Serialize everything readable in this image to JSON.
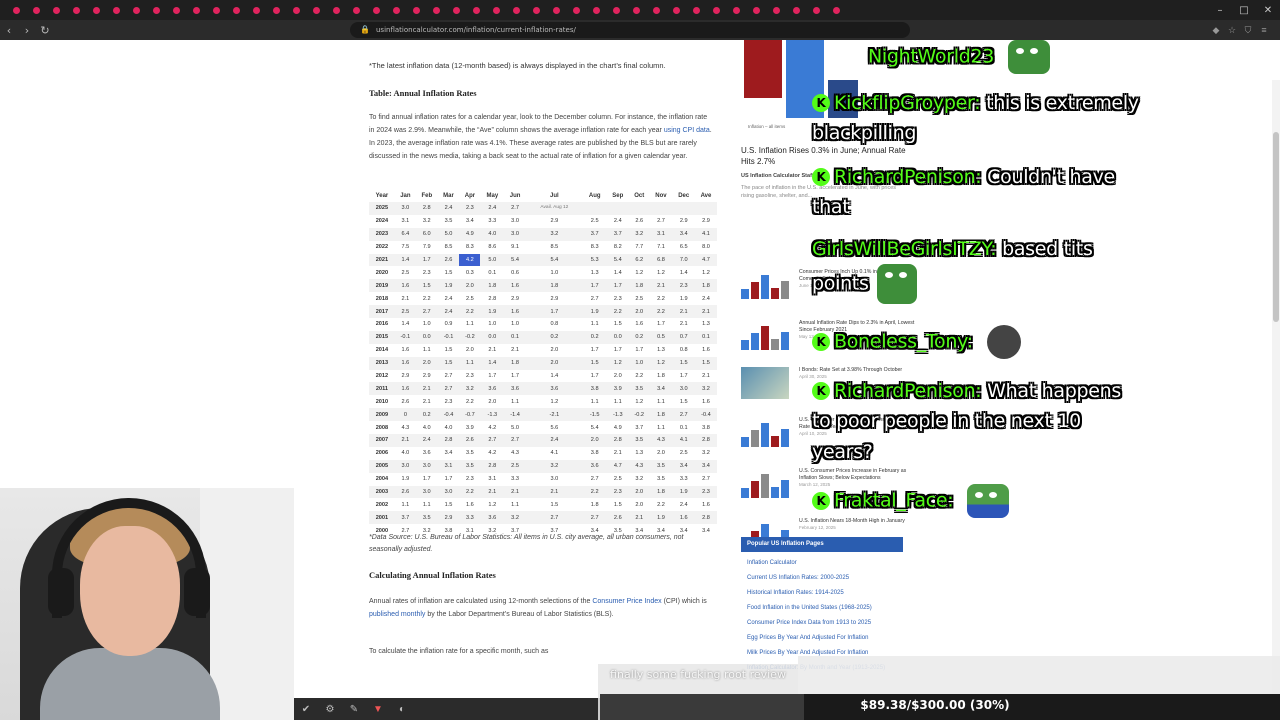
{
  "browser": {
    "url": "usinflationcalculator.com/inflation/current-inflation-rates/"
  },
  "article": {
    "note": "*The latest inflation data (12-month based) is always displayed in the chart’s final column.",
    "table_heading": "Table: Annual Inflation Rates",
    "intro_part1": "To find annual inflation rates for a calendar year, look to the December column. For instance, the inflation rate in 2024 was 2.9%. Meanwhile, the “Ave” column shows the average inflation rate for each year ",
    "intro_link": "using CPI data",
    "intro_part2": ". In 2023, the average inflation rate was 4.1%. These average rates are published by the BLS but are rarely discussed in the news media, taking a back seat to the actual rate of inflation for a given calendar year.",
    "source": "*Data Source: U.S. Bureau of Labor Statistics: All items in U.S. city average, all urban consumers, not seasonally adjusted.",
    "calc_heading": "Calculating Annual Inflation Rates",
    "calc_part1": "Annual rates of inflation are calculated using 12-month selections of the ",
    "calc_link1": "Consumer Price Index",
    "calc_part2": " (CPI) which is ",
    "calc_link2": "published monthly",
    "calc_part3": " by the Labor Department’s Bureau of Labor Statistics (BLS).",
    "calc_more": "To calculate the inflation rate for a specific month, such as"
  },
  "table": {
    "headers": [
      "Year",
      "Jan",
      "Feb",
      "Mar",
      "Apr",
      "May",
      "Jun",
      "Jul",
      "Aug",
      "Sep",
      "Oct",
      "Nov",
      "Dec",
      "Ave"
    ],
    "rows": [
      [
        "2025",
        "3.0",
        "2.8",
        "2.4",
        "2.3",
        "2.4",
        "2.7",
        "Avail. Aug 12",
        "",
        "",
        "",
        "",
        "",
        ""
      ],
      [
        "2024",
        "3.1",
        "3.2",
        "3.5",
        "3.4",
        "3.3",
        "3.0",
        "2.9",
        "2.5",
        "2.4",
        "2.6",
        "2.7",
        "2.9",
        "2.9"
      ],
      [
        "2023",
        "6.4",
        "6.0",
        "5.0",
        "4.9",
        "4.0",
        "3.0",
        "3.2",
        "3.7",
        "3.7",
        "3.2",
        "3.1",
        "3.4",
        "4.1"
      ],
      [
        "2022",
        "7.5",
        "7.9",
        "8.5",
        "8.3",
        "8.6",
        "9.1",
        "8.5",
        "8.3",
        "8.2",
        "7.7",
        "7.1",
        "6.5",
        "8.0"
      ],
      [
        "2021",
        "1.4",
        "1.7",
        "2.6",
        "4.2",
        "5.0",
        "5.4",
        "5.4",
        "5.3",
        "5.4",
        "6.2",
        "6.8",
        "7.0",
        "4.7"
      ],
      [
        "2020",
        "2.5",
        "2.3",
        "1.5",
        "0.3",
        "0.1",
        "0.6",
        "1.0",
        "1.3",
        "1.4",
        "1.2",
        "1.2",
        "1.4",
        "1.2"
      ],
      [
        "2019",
        "1.6",
        "1.5",
        "1.9",
        "2.0",
        "1.8",
        "1.6",
        "1.8",
        "1.7",
        "1.7",
        "1.8",
        "2.1",
        "2.3",
        "1.8"
      ],
      [
        "2018",
        "2.1",
        "2.2",
        "2.4",
        "2.5",
        "2.8",
        "2.9",
        "2.9",
        "2.7",
        "2.3",
        "2.5",
        "2.2",
        "1.9",
        "2.4"
      ],
      [
        "2017",
        "2.5",
        "2.7",
        "2.4",
        "2.2",
        "1.9",
        "1.6",
        "1.7",
        "1.9",
        "2.2",
        "2.0",
        "2.2",
        "2.1",
        "2.1"
      ],
      [
        "2016",
        "1.4",
        "1.0",
        "0.9",
        "1.1",
        "1.0",
        "1.0",
        "0.8",
        "1.1",
        "1.5",
        "1.6",
        "1.7",
        "2.1",
        "1.3"
      ],
      [
        "2015",
        "-0.1",
        "0.0",
        "-0.1",
        "-0.2",
        "0.0",
        "0.1",
        "0.2",
        "0.2",
        "0.0",
        "0.2",
        "0.5",
        "0.7",
        "0.1"
      ],
      [
        "2014",
        "1.6",
        "1.1",
        "1.5",
        "2.0",
        "2.1",
        "2.1",
        "2.0",
        "1.7",
        "1.7",
        "1.7",
        "1.3",
        "0.8",
        "1.6"
      ],
      [
        "2013",
        "1.6",
        "2.0",
        "1.5",
        "1.1",
        "1.4",
        "1.8",
        "2.0",
        "1.5",
        "1.2",
        "1.0",
        "1.2",
        "1.5",
        "1.5"
      ],
      [
        "2012",
        "2.9",
        "2.9",
        "2.7",
        "2.3",
        "1.7",
        "1.7",
        "1.4",
        "1.7",
        "2.0",
        "2.2",
        "1.8",
        "1.7",
        "2.1"
      ],
      [
        "2011",
        "1.6",
        "2.1",
        "2.7",
        "3.2",
        "3.6",
        "3.6",
        "3.6",
        "3.8",
        "3.9",
        "3.5",
        "3.4",
        "3.0",
        "3.2"
      ],
      [
        "2010",
        "2.6",
        "2.1",
        "2.3",
        "2.2",
        "2.0",
        "1.1",
        "1.2",
        "1.1",
        "1.1",
        "1.2",
        "1.1",
        "1.5",
        "1.6"
      ],
      [
        "2009",
        "0",
        "0.2",
        "-0.4",
        "-0.7",
        "-1.3",
        "-1.4",
        "-2.1",
        "-1.5",
        "-1.3",
        "-0.2",
        "1.8",
        "2.7",
        "-0.4"
      ],
      [
        "2008",
        "4.3",
        "4.0",
        "4.0",
        "3.9",
        "4.2",
        "5.0",
        "5.6",
        "5.4",
        "4.9",
        "3.7",
        "1.1",
        "0.1",
        "3.8"
      ],
      [
        "2007",
        "2.1",
        "2.4",
        "2.8",
        "2.6",
        "2.7",
        "2.7",
        "2.4",
        "2.0",
        "2.8",
        "3.5",
        "4.3",
        "4.1",
        "2.8"
      ],
      [
        "2006",
        "4.0",
        "3.6",
        "3.4",
        "3.5",
        "4.2",
        "4.3",
        "4.1",
        "3.8",
        "2.1",
        "1.3",
        "2.0",
        "2.5",
        "3.2"
      ],
      [
        "2005",
        "3.0",
        "3.0",
        "3.1",
        "3.5",
        "2.8",
        "2.5",
        "3.2",
        "3.6",
        "4.7",
        "4.3",
        "3.5",
        "3.4",
        "3.4"
      ],
      [
        "2004",
        "1.9",
        "1.7",
        "1.7",
        "2.3",
        "3.1",
        "3.3",
        "3.0",
        "2.7",
        "2.5",
        "3.2",
        "3.5",
        "3.3",
        "2.7"
      ],
      [
        "2003",
        "2.6",
        "3.0",
        "3.0",
        "2.2",
        "2.1",
        "2.1",
        "2.1",
        "2.2",
        "2.3",
        "2.0",
        "1.8",
        "1.9",
        "2.3"
      ],
      [
        "2002",
        "1.1",
        "1.1",
        "1.5",
        "1.6",
        "1.2",
        "1.1",
        "1.5",
        "1.8",
        "1.5",
        "2.0",
        "2.2",
        "2.4",
        "1.6"
      ],
      [
        "2001",
        "3.7",
        "3.5",
        "2.9",
        "3.3",
        "3.6",
        "3.2",
        "2.7",
        "2.7",
        "2.6",
        "2.1",
        "1.9",
        "1.6",
        "2.8"
      ],
      [
        "2000",
        "2.7",
        "3.2",
        "3.8",
        "3.1",
        "3.2",
        "3.7",
        "3.7",
        "3.4",
        "3.5",
        "3.4",
        "3.4",
        "3.4",
        "3.4"
      ]
    ]
  },
  "sidebar": {
    "mini_caption": "Inflation – all items",
    "headline": "U.S. Inflation Rises 0.3% in June; Annual Rate Hits 2.7%",
    "sub": "US Inflation Calculator Staff",
    "desc": "The pace of inflation in the U.S. accelerated in June, with prices rising gasoline, shelter, and...",
    "related": [
      {
        "title": "Consumer Prices Inch Up 0.1% in May as Inflation Comes in Below Forecasts",
        "date": "June 11, 2025"
      },
      {
        "title": "Annual Inflation Rate Dips to 2.3% in April, Lowest Since February 2021",
        "date": "May 13, 2025"
      },
      {
        "title": "I Bonds: Rate Set at 3.98% Through October",
        "date": "April 30, 2025"
      },
      {
        "title": "U.S. Consumer Prices Fall 0.1%; Annual Inflation Rate at Four-Year Low",
        "date": "April 10, 2025"
      },
      {
        "title": "U.S. Consumer Prices Increase in February as Inflation Slows; Below Expectations",
        "date": "March 12, 2025"
      },
      {
        "title": "U.S. Inflation Nears 18-Month High in January",
        "date": "February 12, 2025"
      }
    ],
    "popular_heading": "Popular US Inflation Pages",
    "popular": [
      "Inflation Calculator",
      "Current US Inflation Rates: 2000-2025",
      "Historical Inflation Rates: 1914-2025",
      "Food Inflation in the United States (1968-2025)",
      "Consumer Price Index Data from 1913 to 2025",
      "Egg Prices By Year And Adjusted For Inflation",
      "Milk Prices By Year And Adjusted For Inflation",
      "Inflation Calculator: By Month and Year (1913-2025)"
    ]
  },
  "chat": {
    "messages": [
      {
        "user": "NightWorld23",
        "text": "",
        "badge": ""
      },
      {
        "user": "KickflipGroyper:",
        "text": "this is extremely blackpilling",
        "badge": "K"
      },
      {
        "user": "RichardPenison:",
        "text": "Couldn't have that",
        "badge": "K"
      },
      {
        "user": "GirlsWillBeGirlsITZY:",
        "text": "based tits points",
        "badge": ""
      },
      {
        "user": "Boneless_Tony:",
        "text": "",
        "badge": "K"
      },
      {
        "user": "RichardPenison:",
        "text": "What happens to poor people in the next 10 years?",
        "badge": "K"
      },
      {
        "user": "Fraktal_Face:",
        "text": "",
        "badge": "K"
      }
    ]
  },
  "overlay": {
    "caption": "finally some fucking root review",
    "goal_text": "$89.38/$300.00 (30%)",
    "goal_fraction": 0.3
  },
  "colors": {
    "kick_green": "#53fc18",
    "link_blue": "#2a5db0",
    "chart_red": "#9e1b1e",
    "chart_blue": "#3a7bd5",
    "highlight": "#3b5fd0"
  }
}
